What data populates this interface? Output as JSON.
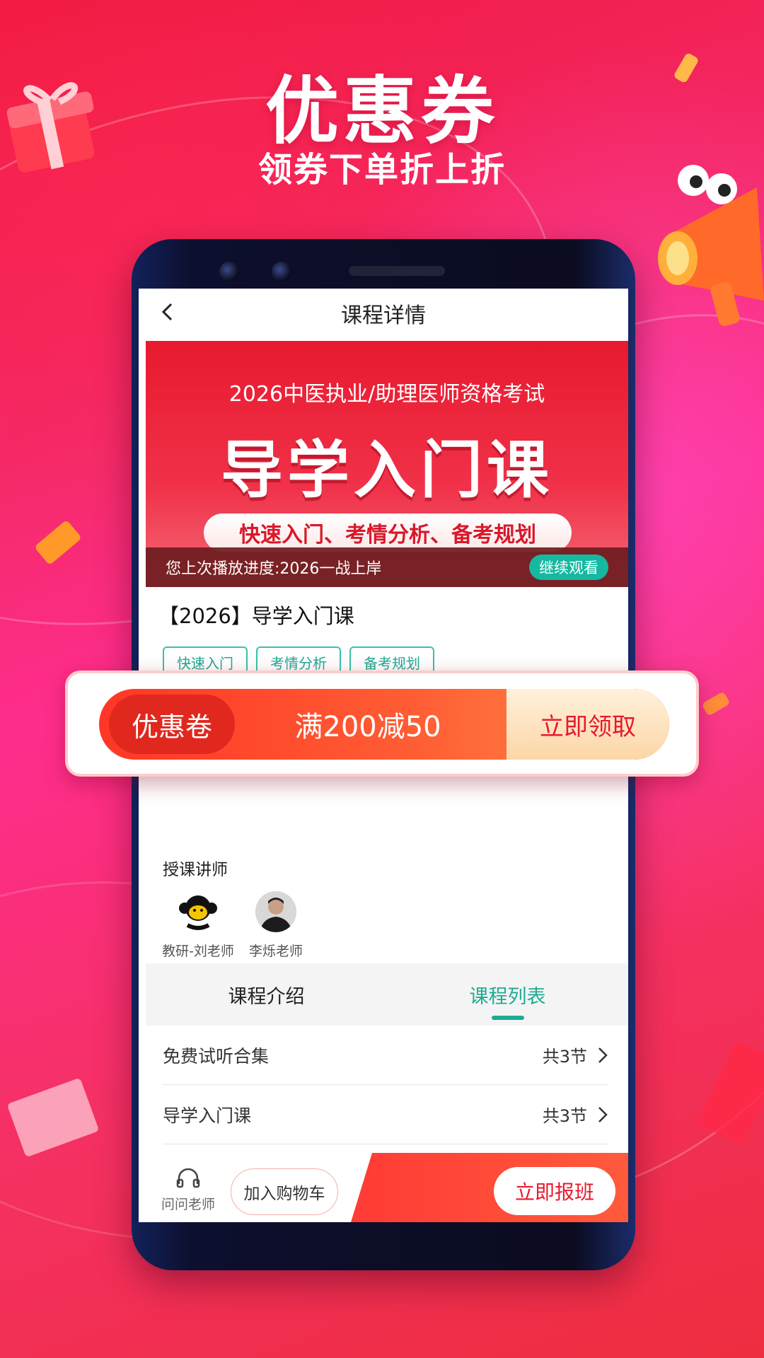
{
  "promo": {
    "title": "优惠券",
    "subtitle": "领券下单折上折"
  },
  "colors": {
    "accent": "#1daa94",
    "brand_red": "#e8192e",
    "coupon_orange": "#ff5d34"
  },
  "screen": {
    "nav": {
      "title": "课程详情",
      "back_icon": "chevron-left-icon"
    },
    "banner": {
      "exam_line": "2026中医执业/助理医师资格考试",
      "course_headline": "导学入门课",
      "features": "快速入门、考情分析、备考规划"
    },
    "progress": {
      "text": "您上次播放进度:2026一战上岸",
      "button": "继续观看"
    },
    "course": {
      "title": "【2026】导学入门课",
      "tags": [
        "快速入门",
        "考情分析",
        "备考规划"
      ]
    },
    "teachers": {
      "heading": "授课讲师",
      "list": [
        {
          "name": "教研-刘老师"
        },
        {
          "name": "李烁老师"
        }
      ]
    },
    "tabs": [
      {
        "label": "课程介绍",
        "active": false
      },
      {
        "label": "课程列表",
        "active": true
      }
    ],
    "lessons": [
      {
        "title": "免费试听合集",
        "count": "共3节"
      },
      {
        "title": "导学入门课",
        "count": "共3节"
      }
    ],
    "bottom_bar": {
      "ask": "问问老师",
      "cart": "加入购物车",
      "enroll": "立即报班"
    }
  },
  "coupon": {
    "badge": "优惠卷",
    "amount": "满200减50",
    "claim": "立即领取"
  }
}
